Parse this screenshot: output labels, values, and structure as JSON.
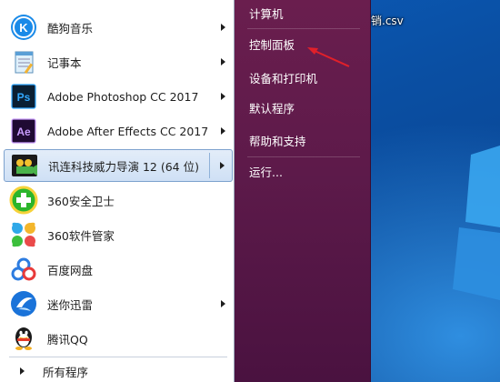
{
  "desktop": {
    "file_label": "销.csv"
  },
  "start_menu": {
    "programs": [
      {
        "label": "酷狗音乐",
        "icon": "kugou-music-icon",
        "has_submenu": true,
        "selected": false
      },
      {
        "label": "记事本",
        "icon": "notepad-icon",
        "has_submenu": true,
        "selected": false
      },
      {
        "label": "Adobe Photoshop CC 2017",
        "icon": "photoshop-icon",
        "has_submenu": true,
        "selected": false
      },
      {
        "label": "Adobe After Effects CC 2017",
        "icon": "after-effects-icon",
        "has_submenu": true,
        "selected": false
      },
      {
        "label": "讯连科技威力导演 12 (64 位)",
        "icon": "powerdirector-icon",
        "has_submenu": true,
        "selected": true
      },
      {
        "label": "360安全卫士",
        "icon": "360-safe-icon",
        "has_submenu": false,
        "selected": false
      },
      {
        "label": "360软件管家",
        "icon": "360-software-manager-icon",
        "has_submenu": false,
        "selected": false
      },
      {
        "label": "百度网盘",
        "icon": "baidu-netdisk-icon",
        "has_submenu": false,
        "selected": false
      },
      {
        "label": "迷你迅雷",
        "icon": "mini-thunder-icon",
        "has_submenu": true,
        "selected": false
      },
      {
        "label": "腾讯QQ",
        "icon": "qq-penguin-icon",
        "has_submenu": false,
        "selected": false
      }
    ],
    "all_programs_label": "所有程序",
    "places": [
      {
        "label": "计算机"
      },
      {
        "label": "控制面板"
      },
      {
        "label": "设备和打印机"
      },
      {
        "label": "默认程序"
      },
      {
        "label": "帮助和支持"
      },
      {
        "label": "运行..."
      }
    ],
    "colors": {
      "menu_bg": "#5d1a4a",
      "selected_bg": "#cfe0f5",
      "annotation_arrow": "#e0202a"
    }
  }
}
